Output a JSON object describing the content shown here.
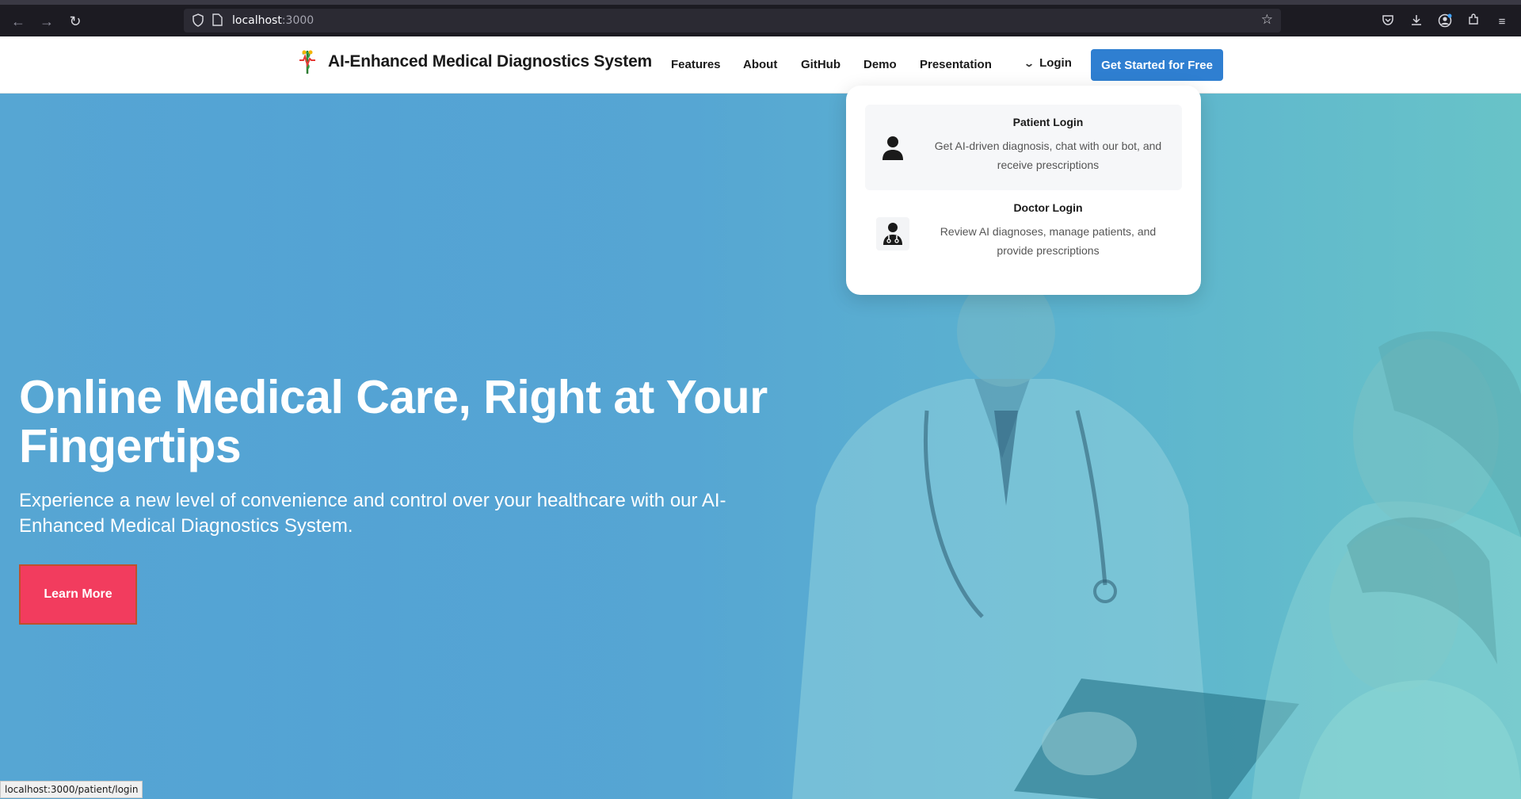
{
  "browser": {
    "url_host": "localhost",
    "url_port": ":3000"
  },
  "header": {
    "brand_name": "AI-Enhanced Medical Diagnostics System",
    "nav": {
      "features": "Features",
      "about": "About",
      "github": "GitHub",
      "demo": "Demo",
      "presentation": "Presentation"
    },
    "login_label": "Login",
    "cta_label": "Get Started for Free"
  },
  "login_menu": {
    "patient": {
      "title": "Patient Login",
      "description": "Get AI-driven diagnosis, chat with our bot, and receive prescriptions"
    },
    "doctor": {
      "title": "Doctor Login",
      "description": "Review AI diagnoses, manage patients, and provide prescriptions"
    }
  },
  "hero": {
    "title": "Online Medical Care, Right at Your Fingertips",
    "subtitle": "Experience a new level of convenience and control over your healthcare with our AI-Enhanced Medical Diagnostics System.",
    "button_label": "Learn More"
  },
  "status_url": "localhost:3000/patient/login",
  "colors": {
    "accent_blue": "#2f7fd1",
    "cta_red": "#f23c5e"
  }
}
